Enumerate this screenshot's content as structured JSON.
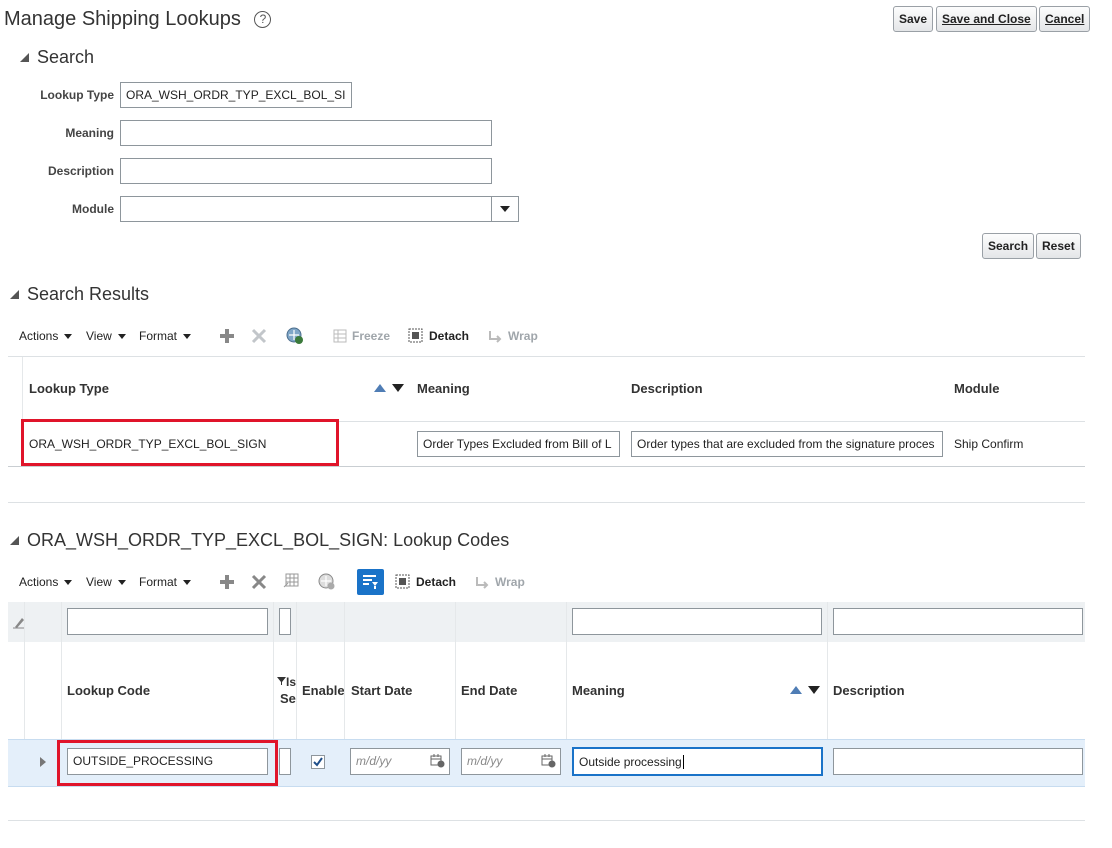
{
  "header": {
    "title": "Manage Shipping Lookups",
    "help_glyph": "?",
    "save_label": "Save",
    "save_close_label": "Save and Close",
    "cancel_label": "Cancel"
  },
  "search": {
    "title": "Search",
    "fields": {
      "lookup_type_label": "Lookup Type",
      "lookup_type_value": "ORA_WSH_ORDR_TYP_EXCL_BOL_SI",
      "meaning_label": "Meaning",
      "meaning_value": "",
      "description_label": "Description",
      "description_value": "",
      "module_label": "Module",
      "module_value": ""
    },
    "search_button": "Search",
    "reset_button": "Reset"
  },
  "results": {
    "title": "Search Results",
    "toolbar": {
      "actions": "Actions",
      "view": "View",
      "format": "Format",
      "freeze": "Freeze",
      "detach": "Detach",
      "wrap": "Wrap"
    },
    "columns": [
      "Lookup Type",
      "Meaning",
      "Description",
      "Module"
    ],
    "row": {
      "lookup_type": "ORA_WSH_ORDR_TYP_EXCL_BOL_SIGN",
      "meaning": "Order Types Excluded from Bill of L",
      "description": "Order types that are excluded from the signature proces",
      "module": "Ship Confirm"
    }
  },
  "codes": {
    "title": "ORA_WSH_ORDR_TYP_EXCL_BOL_SIGN: Lookup Codes",
    "toolbar": {
      "actions": "Actions",
      "view": "View",
      "format": "Format",
      "detach": "Detach",
      "wrap": "Wrap"
    },
    "columns": {
      "lookup_code": "Lookup Code",
      "seed_top": "Is",
      "seed_bottom": "Se",
      "enabled": "Enable",
      "start_date": "Start Date",
      "end_date": "End Date",
      "meaning": "Meaning",
      "description": "Description"
    },
    "row": {
      "lookup_code": "OUTSIDE_PROCESSING",
      "enabled": true,
      "start_date_placeholder": "m/d/yy",
      "end_date_placeholder": "m/d/yy",
      "meaning": "Outside processing",
      "description": ""
    }
  },
  "colors": {
    "highlight_box": "#e0142a",
    "selected_row": "#e4effa",
    "accent": "#1a73c8"
  }
}
